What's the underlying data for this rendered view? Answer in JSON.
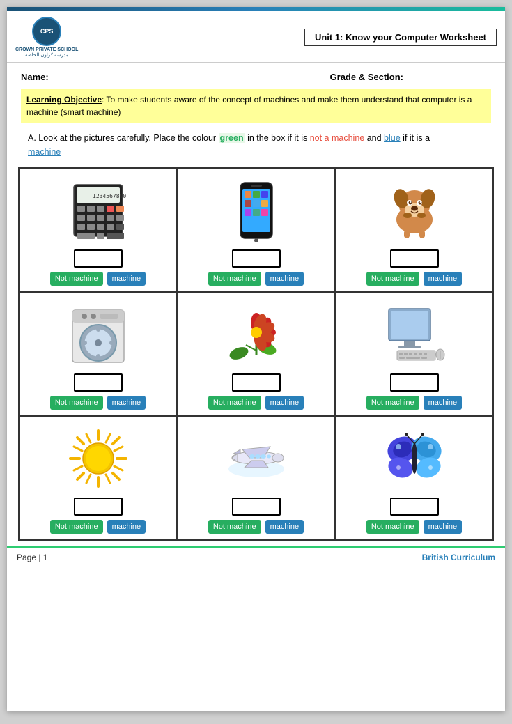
{
  "header": {
    "school_en": "CROWN PRIVATE SCHOOL",
    "school_ar": "مدرسة كراون الخاصة",
    "logo_text": "CPS",
    "worksheet_title": "Unit 1: Know your Computer Worksheet"
  },
  "form": {
    "name_label": "Name:",
    "grade_label": "Grade & Section:"
  },
  "learning_objective": {
    "label": "Learning Objective",
    "text": ": To make students aware of the concept of machines and make them understand that computer is a machine (smart machine)"
  },
  "instructions": {
    "prefix": "A.",
    "text1": "Look at the pictures carefully. Place the colour ",
    "green_word": "green",
    "text2": " in the box if it is ",
    "red_word": "not a machine",
    "text3": " and ",
    "blue_word": "blue",
    "text4": " if it is a ",
    "link_word": "machine"
  },
  "grid": {
    "rows": [
      {
        "cells": [
          {
            "id": "calculator",
            "label": "Calculator",
            "is_machine": true
          },
          {
            "id": "phone",
            "label": "Phone",
            "is_machine": true
          },
          {
            "id": "dog",
            "label": "Dog",
            "is_machine": false
          }
        ]
      },
      {
        "cells": [
          {
            "id": "washer",
            "label": "Washing Machine",
            "is_machine": true
          },
          {
            "id": "flower",
            "label": "Flower",
            "is_machine": false
          },
          {
            "id": "computer",
            "label": "Computer",
            "is_machine": true
          }
        ]
      },
      {
        "cells": [
          {
            "id": "sun",
            "label": "Sun",
            "is_machine": false
          },
          {
            "id": "plane",
            "label": "Airplane",
            "is_machine": true
          },
          {
            "id": "butterfly",
            "label": "Butterfly",
            "is_machine": false
          }
        ]
      }
    ]
  },
  "buttons": {
    "not_machine": "Not machine",
    "machine": "machine"
  },
  "footer": {
    "page": "Page | 1",
    "curriculum": "British Curriculum"
  }
}
